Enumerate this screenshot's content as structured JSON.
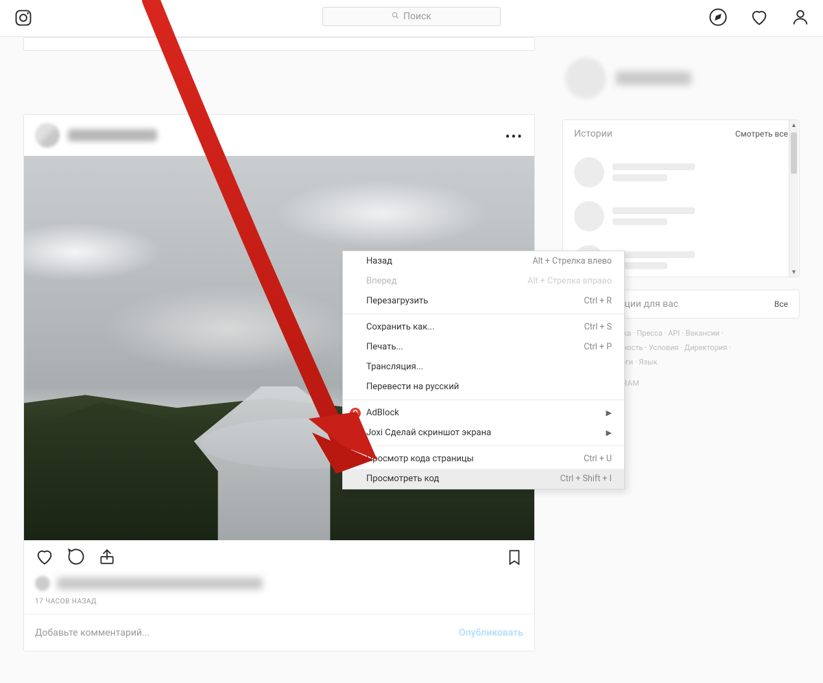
{
  "header": {
    "search_placeholder": "Поиск"
  },
  "post": {
    "timestamp": "17 ЧАСОВ НАЗАД",
    "comment_placeholder": "Добавьте комментарий...",
    "publish_label": "Опубликовать"
  },
  "sidebar": {
    "stories_title": "Истории",
    "stories_all": "Смотреть все",
    "recs_title": "Рекомендации для вас",
    "recs_all": "Все"
  },
  "footer": {
    "line1": "О нас · Поддержка · Пресса · API · Вакансии ·",
    "line2": "Конфиденциальность · Условия · Директория ·",
    "line3": "Профили · Хэштеги · Язык",
    "brand": "© 2018 INSTAGRAM"
  },
  "context_menu": {
    "back": {
      "label": "Назад",
      "shortcut": "Alt + Стрелка влево"
    },
    "forward": {
      "label": "Вперед",
      "shortcut": "Alt + Стрелка вправо"
    },
    "reload": {
      "label": "Перезагрузить",
      "shortcut": "Ctrl + R"
    },
    "save_as": {
      "label": "Сохранить как...",
      "shortcut": "Ctrl + S"
    },
    "print": {
      "label": "Печать...",
      "shortcut": "Ctrl + P"
    },
    "cast": {
      "label": "Трансляция..."
    },
    "translate": {
      "label": "Перевести на русский"
    },
    "adblock": {
      "label": "AdBlock"
    },
    "joxi": {
      "label": "Joxi Сделай скриншот экрана"
    },
    "view_source": {
      "label": "Просмотр кода страницы",
      "shortcut": "Ctrl + U"
    },
    "inspect": {
      "label": "Просмотреть код",
      "shortcut": "Ctrl + Shift + I"
    }
  }
}
